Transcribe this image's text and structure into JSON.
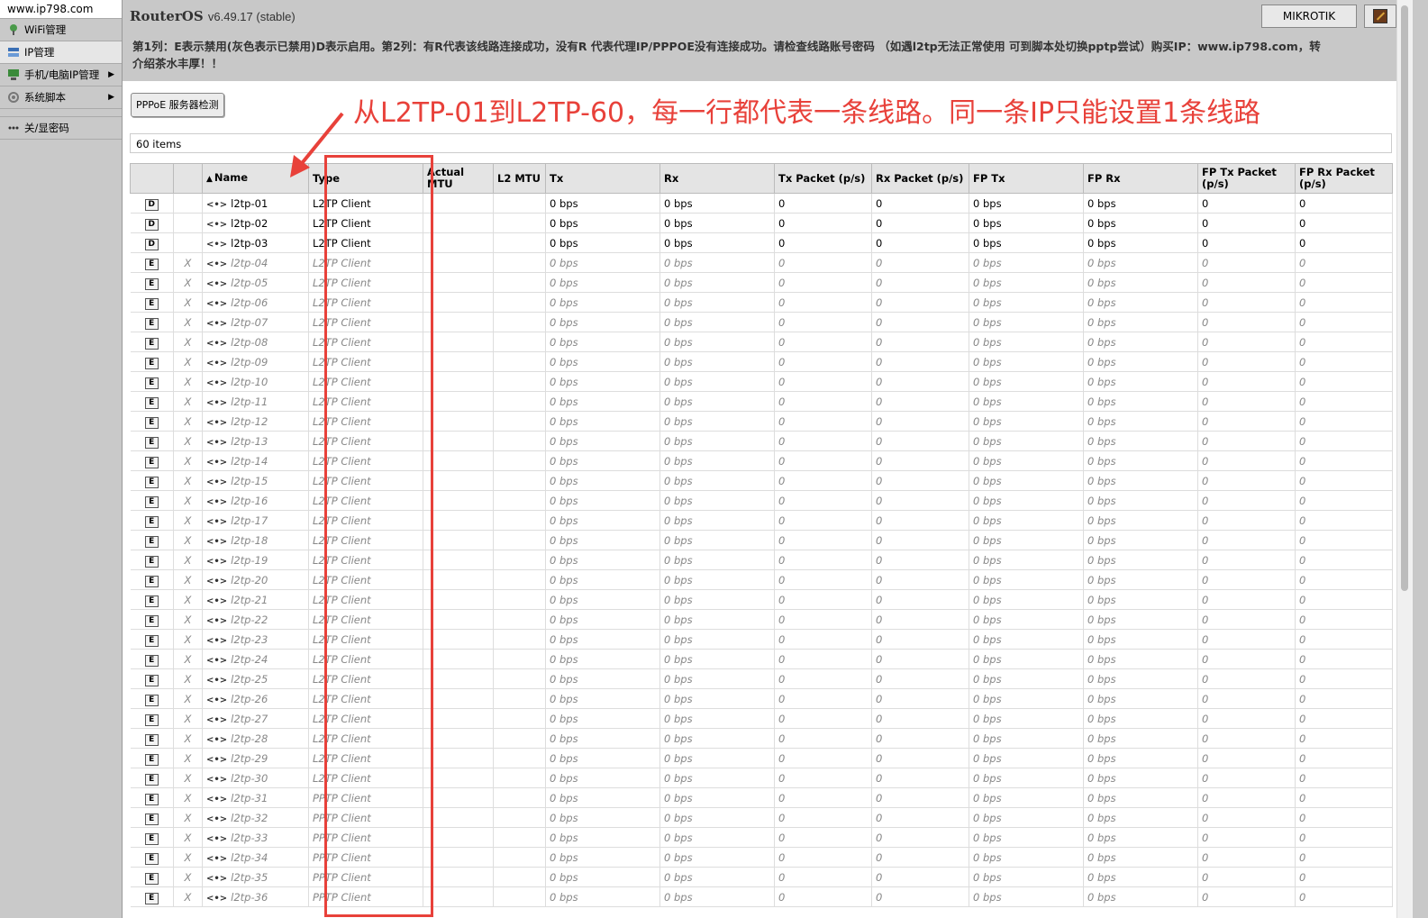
{
  "sidebar": {
    "site": "www.ip798.com",
    "items": [
      {
        "label": "WiFi管理",
        "icon": "wifi-icon"
      },
      {
        "label": "IP管理",
        "icon": "ip-manage-icon"
      },
      {
        "label": "手机/电脑IP管理",
        "icon": "device-ip-icon",
        "submenu_arrow": "▶"
      },
      {
        "label": "系统脚本",
        "icon": "script-icon",
        "submenu_arrow": "▶"
      }
    ],
    "password_item": {
      "label": "关/显密码",
      "icon": "password-dots-icon"
    }
  },
  "header": {
    "title": "RouterOS",
    "version": "v6.49.17 (stable)",
    "note": "第1列：E表示禁用(灰色表示已禁用)D表示启用。第2列：有R代表该线路连接成功，没有R 代表代理IP/PPPOE没有连接成功。请检查线路账号密码 （如遇l2tp无法正常使用 可到脚本处切换pptp尝试）购买IP：www.ip798.com，转介绍茶水丰厚！！",
    "mikrotik_button": "MIKROTIK"
  },
  "toolbar": {
    "pppoe_button": "PPPoE 服务器检测"
  },
  "annotation": "从L2TP-01到L2TP-60，每一行都代表一条线路。同一条IP只能设置1条线路",
  "items_count": "60 items",
  "table": {
    "sort_indicator": "▲",
    "columns": [
      "",
      "",
      "Name",
      "Type",
      "Actual MTU",
      "L2 MTU",
      "Tx",
      "Rx",
      "Tx Packet (p/s)",
      "Rx Packet (p/s)",
      "FP Tx",
      "FP Rx",
      "FP Tx Packet (p/s)",
      "FP Rx Packet (p/s)"
    ],
    "interface_icon": "<•>",
    "rows": [
      {
        "flag": "D",
        "status": "",
        "name": "l2tp-01",
        "type": "L2TP Client",
        "actual_mtu": "",
        "l2_mtu": "",
        "tx": "0 bps",
        "rx": "0 bps",
        "tx_pps": "0",
        "rx_pps": "0",
        "fp_tx": "0 bps",
        "fp_rx": "0 bps",
        "fp_tx_pps": "0",
        "fp_rx_pps": "0",
        "disabled": false
      },
      {
        "flag": "D",
        "status": "",
        "name": "l2tp-02",
        "type": "L2TP Client",
        "actual_mtu": "",
        "l2_mtu": "",
        "tx": "0 bps",
        "rx": "0 bps",
        "tx_pps": "0",
        "rx_pps": "0",
        "fp_tx": "0 bps",
        "fp_rx": "0 bps",
        "fp_tx_pps": "0",
        "fp_rx_pps": "0",
        "disabled": false
      },
      {
        "flag": "D",
        "status": "",
        "name": "l2tp-03",
        "type": "L2TP Client",
        "actual_mtu": "",
        "l2_mtu": "",
        "tx": "0 bps",
        "rx": "0 bps",
        "tx_pps": "0",
        "rx_pps": "0",
        "fp_tx": "0 bps",
        "fp_rx": "0 bps",
        "fp_tx_pps": "0",
        "fp_rx_pps": "0",
        "disabled": false
      },
      {
        "flag": "E",
        "status": "X",
        "name": "l2tp-04",
        "type": "L2TP Client",
        "actual_mtu": "",
        "l2_mtu": "",
        "tx": "0 bps",
        "rx": "0 bps",
        "tx_pps": "0",
        "rx_pps": "0",
        "fp_tx": "0 bps",
        "fp_rx": "0 bps",
        "fp_tx_pps": "0",
        "fp_rx_pps": "0",
        "disabled": true
      },
      {
        "flag": "E",
        "status": "X",
        "name": "l2tp-05",
        "type": "L2TP Client",
        "actual_mtu": "",
        "l2_mtu": "",
        "tx": "0 bps",
        "rx": "0 bps",
        "tx_pps": "0",
        "rx_pps": "0",
        "fp_tx": "0 bps",
        "fp_rx": "0 bps",
        "fp_tx_pps": "0",
        "fp_rx_pps": "0",
        "disabled": true
      },
      {
        "flag": "E",
        "status": "X",
        "name": "l2tp-06",
        "type": "L2TP Client",
        "actual_mtu": "",
        "l2_mtu": "",
        "tx": "0 bps",
        "rx": "0 bps",
        "tx_pps": "0",
        "rx_pps": "0",
        "fp_tx": "0 bps",
        "fp_rx": "0 bps",
        "fp_tx_pps": "0",
        "fp_rx_pps": "0",
        "disabled": true
      },
      {
        "flag": "E",
        "status": "X",
        "name": "l2tp-07",
        "type": "L2TP Client",
        "actual_mtu": "",
        "l2_mtu": "",
        "tx": "0 bps",
        "rx": "0 bps",
        "tx_pps": "0",
        "rx_pps": "0",
        "fp_tx": "0 bps",
        "fp_rx": "0 bps",
        "fp_tx_pps": "0",
        "fp_rx_pps": "0",
        "disabled": true
      },
      {
        "flag": "E",
        "status": "X",
        "name": "l2tp-08",
        "type": "L2TP Client",
        "actual_mtu": "",
        "l2_mtu": "",
        "tx": "0 bps",
        "rx": "0 bps",
        "tx_pps": "0",
        "rx_pps": "0",
        "fp_tx": "0 bps",
        "fp_rx": "0 bps",
        "fp_tx_pps": "0",
        "fp_rx_pps": "0",
        "disabled": true
      },
      {
        "flag": "E",
        "status": "X",
        "name": "l2tp-09",
        "type": "L2TP Client",
        "actual_mtu": "",
        "l2_mtu": "",
        "tx": "0 bps",
        "rx": "0 bps",
        "tx_pps": "0",
        "rx_pps": "0",
        "fp_tx": "0 bps",
        "fp_rx": "0 bps",
        "fp_tx_pps": "0",
        "fp_rx_pps": "0",
        "disabled": true
      },
      {
        "flag": "E",
        "status": "X",
        "name": "l2tp-10",
        "type": "L2TP Client",
        "actual_mtu": "",
        "l2_mtu": "",
        "tx": "0 bps",
        "rx": "0 bps",
        "tx_pps": "0",
        "rx_pps": "0",
        "fp_tx": "0 bps",
        "fp_rx": "0 bps",
        "fp_tx_pps": "0",
        "fp_rx_pps": "0",
        "disabled": true
      },
      {
        "flag": "E",
        "status": "X",
        "name": "l2tp-11",
        "type": "L2TP Client",
        "actual_mtu": "",
        "l2_mtu": "",
        "tx": "0 bps",
        "rx": "0 bps",
        "tx_pps": "0",
        "rx_pps": "0",
        "fp_tx": "0 bps",
        "fp_rx": "0 bps",
        "fp_tx_pps": "0",
        "fp_rx_pps": "0",
        "disabled": true
      },
      {
        "flag": "E",
        "status": "X",
        "name": "l2tp-12",
        "type": "L2TP Client",
        "actual_mtu": "",
        "l2_mtu": "",
        "tx": "0 bps",
        "rx": "0 bps",
        "tx_pps": "0",
        "rx_pps": "0",
        "fp_tx": "0 bps",
        "fp_rx": "0 bps",
        "fp_tx_pps": "0",
        "fp_rx_pps": "0",
        "disabled": true
      },
      {
        "flag": "E",
        "status": "X",
        "name": "l2tp-13",
        "type": "L2TP Client",
        "actual_mtu": "",
        "l2_mtu": "",
        "tx": "0 bps",
        "rx": "0 bps",
        "tx_pps": "0",
        "rx_pps": "0",
        "fp_tx": "0 bps",
        "fp_rx": "0 bps",
        "fp_tx_pps": "0",
        "fp_rx_pps": "0",
        "disabled": true
      },
      {
        "flag": "E",
        "status": "X",
        "name": "l2tp-14",
        "type": "L2TP Client",
        "actual_mtu": "",
        "l2_mtu": "",
        "tx": "0 bps",
        "rx": "0 bps",
        "tx_pps": "0",
        "rx_pps": "0",
        "fp_tx": "0 bps",
        "fp_rx": "0 bps",
        "fp_tx_pps": "0",
        "fp_rx_pps": "0",
        "disabled": true
      },
      {
        "flag": "E",
        "status": "X",
        "name": "l2tp-15",
        "type": "L2TP Client",
        "actual_mtu": "",
        "l2_mtu": "",
        "tx": "0 bps",
        "rx": "0 bps",
        "tx_pps": "0",
        "rx_pps": "0",
        "fp_tx": "0 bps",
        "fp_rx": "0 bps",
        "fp_tx_pps": "0",
        "fp_rx_pps": "0",
        "disabled": true
      },
      {
        "flag": "E",
        "status": "X",
        "name": "l2tp-16",
        "type": "L2TP Client",
        "actual_mtu": "",
        "l2_mtu": "",
        "tx": "0 bps",
        "rx": "0 bps",
        "tx_pps": "0",
        "rx_pps": "0",
        "fp_tx": "0 bps",
        "fp_rx": "0 bps",
        "fp_tx_pps": "0",
        "fp_rx_pps": "0",
        "disabled": true
      },
      {
        "flag": "E",
        "status": "X",
        "name": "l2tp-17",
        "type": "L2TP Client",
        "actual_mtu": "",
        "l2_mtu": "",
        "tx": "0 bps",
        "rx": "0 bps",
        "tx_pps": "0",
        "rx_pps": "0",
        "fp_tx": "0 bps",
        "fp_rx": "0 bps",
        "fp_tx_pps": "0",
        "fp_rx_pps": "0",
        "disabled": true
      },
      {
        "flag": "E",
        "status": "X",
        "name": "l2tp-18",
        "type": "L2TP Client",
        "actual_mtu": "",
        "l2_mtu": "",
        "tx": "0 bps",
        "rx": "0 bps",
        "tx_pps": "0",
        "rx_pps": "0",
        "fp_tx": "0 bps",
        "fp_rx": "0 bps",
        "fp_tx_pps": "0",
        "fp_rx_pps": "0",
        "disabled": true
      },
      {
        "flag": "E",
        "status": "X",
        "name": "l2tp-19",
        "type": "L2TP Client",
        "actual_mtu": "",
        "l2_mtu": "",
        "tx": "0 bps",
        "rx": "0 bps",
        "tx_pps": "0",
        "rx_pps": "0",
        "fp_tx": "0 bps",
        "fp_rx": "0 bps",
        "fp_tx_pps": "0",
        "fp_rx_pps": "0",
        "disabled": true
      },
      {
        "flag": "E",
        "status": "X",
        "name": "l2tp-20",
        "type": "L2TP Client",
        "actual_mtu": "",
        "l2_mtu": "",
        "tx": "0 bps",
        "rx": "0 bps",
        "tx_pps": "0",
        "rx_pps": "0",
        "fp_tx": "0 bps",
        "fp_rx": "0 bps",
        "fp_tx_pps": "0",
        "fp_rx_pps": "0",
        "disabled": true
      },
      {
        "flag": "E",
        "status": "X",
        "name": "l2tp-21",
        "type": "L2TP Client",
        "actual_mtu": "",
        "l2_mtu": "",
        "tx": "0 bps",
        "rx": "0 bps",
        "tx_pps": "0",
        "rx_pps": "0",
        "fp_tx": "0 bps",
        "fp_rx": "0 bps",
        "fp_tx_pps": "0",
        "fp_rx_pps": "0",
        "disabled": true
      },
      {
        "flag": "E",
        "status": "X",
        "name": "l2tp-22",
        "type": "L2TP Client",
        "actual_mtu": "",
        "l2_mtu": "",
        "tx": "0 bps",
        "rx": "0 bps",
        "tx_pps": "0",
        "rx_pps": "0",
        "fp_tx": "0 bps",
        "fp_rx": "0 bps",
        "fp_tx_pps": "0",
        "fp_rx_pps": "0",
        "disabled": true
      },
      {
        "flag": "E",
        "status": "X",
        "name": "l2tp-23",
        "type": "L2TP Client",
        "actual_mtu": "",
        "l2_mtu": "",
        "tx": "0 bps",
        "rx": "0 bps",
        "tx_pps": "0",
        "rx_pps": "0",
        "fp_tx": "0 bps",
        "fp_rx": "0 bps",
        "fp_tx_pps": "0",
        "fp_rx_pps": "0",
        "disabled": true
      },
      {
        "flag": "E",
        "status": "X",
        "name": "l2tp-24",
        "type": "L2TP Client",
        "actual_mtu": "",
        "l2_mtu": "",
        "tx": "0 bps",
        "rx": "0 bps",
        "tx_pps": "0",
        "rx_pps": "0",
        "fp_tx": "0 bps",
        "fp_rx": "0 bps",
        "fp_tx_pps": "0",
        "fp_rx_pps": "0",
        "disabled": true
      },
      {
        "flag": "E",
        "status": "X",
        "name": "l2tp-25",
        "type": "L2TP Client",
        "actual_mtu": "",
        "l2_mtu": "",
        "tx": "0 bps",
        "rx": "0 bps",
        "tx_pps": "0",
        "rx_pps": "0",
        "fp_tx": "0 bps",
        "fp_rx": "0 bps",
        "fp_tx_pps": "0",
        "fp_rx_pps": "0",
        "disabled": true
      },
      {
        "flag": "E",
        "status": "X",
        "name": "l2tp-26",
        "type": "L2TP Client",
        "actual_mtu": "",
        "l2_mtu": "",
        "tx": "0 bps",
        "rx": "0 bps",
        "tx_pps": "0",
        "rx_pps": "0",
        "fp_tx": "0 bps",
        "fp_rx": "0 bps",
        "fp_tx_pps": "0",
        "fp_rx_pps": "0",
        "disabled": true
      },
      {
        "flag": "E",
        "status": "X",
        "name": "l2tp-27",
        "type": "L2TP Client",
        "actual_mtu": "",
        "l2_mtu": "",
        "tx": "0 bps",
        "rx": "0 bps",
        "tx_pps": "0",
        "rx_pps": "0",
        "fp_tx": "0 bps",
        "fp_rx": "0 bps",
        "fp_tx_pps": "0",
        "fp_rx_pps": "0",
        "disabled": true
      },
      {
        "flag": "E",
        "status": "X",
        "name": "l2tp-28",
        "type": "L2TP Client",
        "actual_mtu": "",
        "l2_mtu": "",
        "tx": "0 bps",
        "rx": "0 bps",
        "tx_pps": "0",
        "rx_pps": "0",
        "fp_tx": "0 bps",
        "fp_rx": "0 bps",
        "fp_tx_pps": "0",
        "fp_rx_pps": "0",
        "disabled": true
      },
      {
        "flag": "E",
        "status": "X",
        "name": "l2tp-29",
        "type": "L2TP Client",
        "actual_mtu": "",
        "l2_mtu": "",
        "tx": "0 bps",
        "rx": "0 bps",
        "tx_pps": "0",
        "rx_pps": "0",
        "fp_tx": "0 bps",
        "fp_rx": "0 bps",
        "fp_tx_pps": "0",
        "fp_rx_pps": "0",
        "disabled": true
      },
      {
        "flag": "E",
        "status": "X",
        "name": "l2tp-30",
        "type": "L2TP Client",
        "actual_mtu": "",
        "l2_mtu": "",
        "tx": "0 bps",
        "rx": "0 bps",
        "tx_pps": "0",
        "rx_pps": "0",
        "fp_tx": "0 bps",
        "fp_rx": "0 bps",
        "fp_tx_pps": "0",
        "fp_rx_pps": "0",
        "disabled": true
      },
      {
        "flag": "E",
        "status": "X",
        "name": "l2tp-31",
        "type": "PPTP Client",
        "actual_mtu": "",
        "l2_mtu": "",
        "tx": "0 bps",
        "rx": "0 bps",
        "tx_pps": "0",
        "rx_pps": "0",
        "fp_tx": "0 bps",
        "fp_rx": "0 bps",
        "fp_tx_pps": "0",
        "fp_rx_pps": "0",
        "disabled": true
      },
      {
        "flag": "E",
        "status": "X",
        "name": "l2tp-32",
        "type": "PPTP Client",
        "actual_mtu": "",
        "l2_mtu": "",
        "tx": "0 bps",
        "rx": "0 bps",
        "tx_pps": "0",
        "rx_pps": "0",
        "fp_tx": "0 bps",
        "fp_rx": "0 bps",
        "fp_tx_pps": "0",
        "fp_rx_pps": "0",
        "disabled": true
      },
      {
        "flag": "E",
        "status": "X",
        "name": "l2tp-33",
        "type": "PPTP Client",
        "actual_mtu": "",
        "l2_mtu": "",
        "tx": "0 bps",
        "rx": "0 bps",
        "tx_pps": "0",
        "rx_pps": "0",
        "fp_tx": "0 bps",
        "fp_rx": "0 bps",
        "fp_tx_pps": "0",
        "fp_rx_pps": "0",
        "disabled": true
      },
      {
        "flag": "E",
        "status": "X",
        "name": "l2tp-34",
        "type": "PPTP Client",
        "actual_mtu": "",
        "l2_mtu": "",
        "tx": "0 bps",
        "rx": "0 bps",
        "tx_pps": "0",
        "rx_pps": "0",
        "fp_tx": "0 bps",
        "fp_rx": "0 bps",
        "fp_tx_pps": "0",
        "fp_rx_pps": "0",
        "disabled": true
      },
      {
        "flag": "E",
        "status": "X",
        "name": "l2tp-35",
        "type": "PPTP Client",
        "actual_mtu": "",
        "l2_mtu": "",
        "tx": "0 bps",
        "rx": "0 bps",
        "tx_pps": "0",
        "rx_pps": "0",
        "fp_tx": "0 bps",
        "fp_rx": "0 bps",
        "fp_tx_pps": "0",
        "fp_rx_pps": "0",
        "disabled": true
      },
      {
        "flag": "E",
        "status": "X",
        "name": "l2tp-36",
        "type": "PPTP Client",
        "actual_mtu": "",
        "l2_mtu": "",
        "tx": "0 bps",
        "rx": "0 bps",
        "tx_pps": "0",
        "rx_pps": "0",
        "fp_tx": "0 bps",
        "fp_rx": "0 bps",
        "fp_tx_pps": "0",
        "fp_rx_pps": "0",
        "disabled": true
      }
    ]
  },
  "colors": {
    "annotation_red": "#e8413a",
    "header_bg": "#c8c8c8",
    "disabled_text": "#888888"
  }
}
